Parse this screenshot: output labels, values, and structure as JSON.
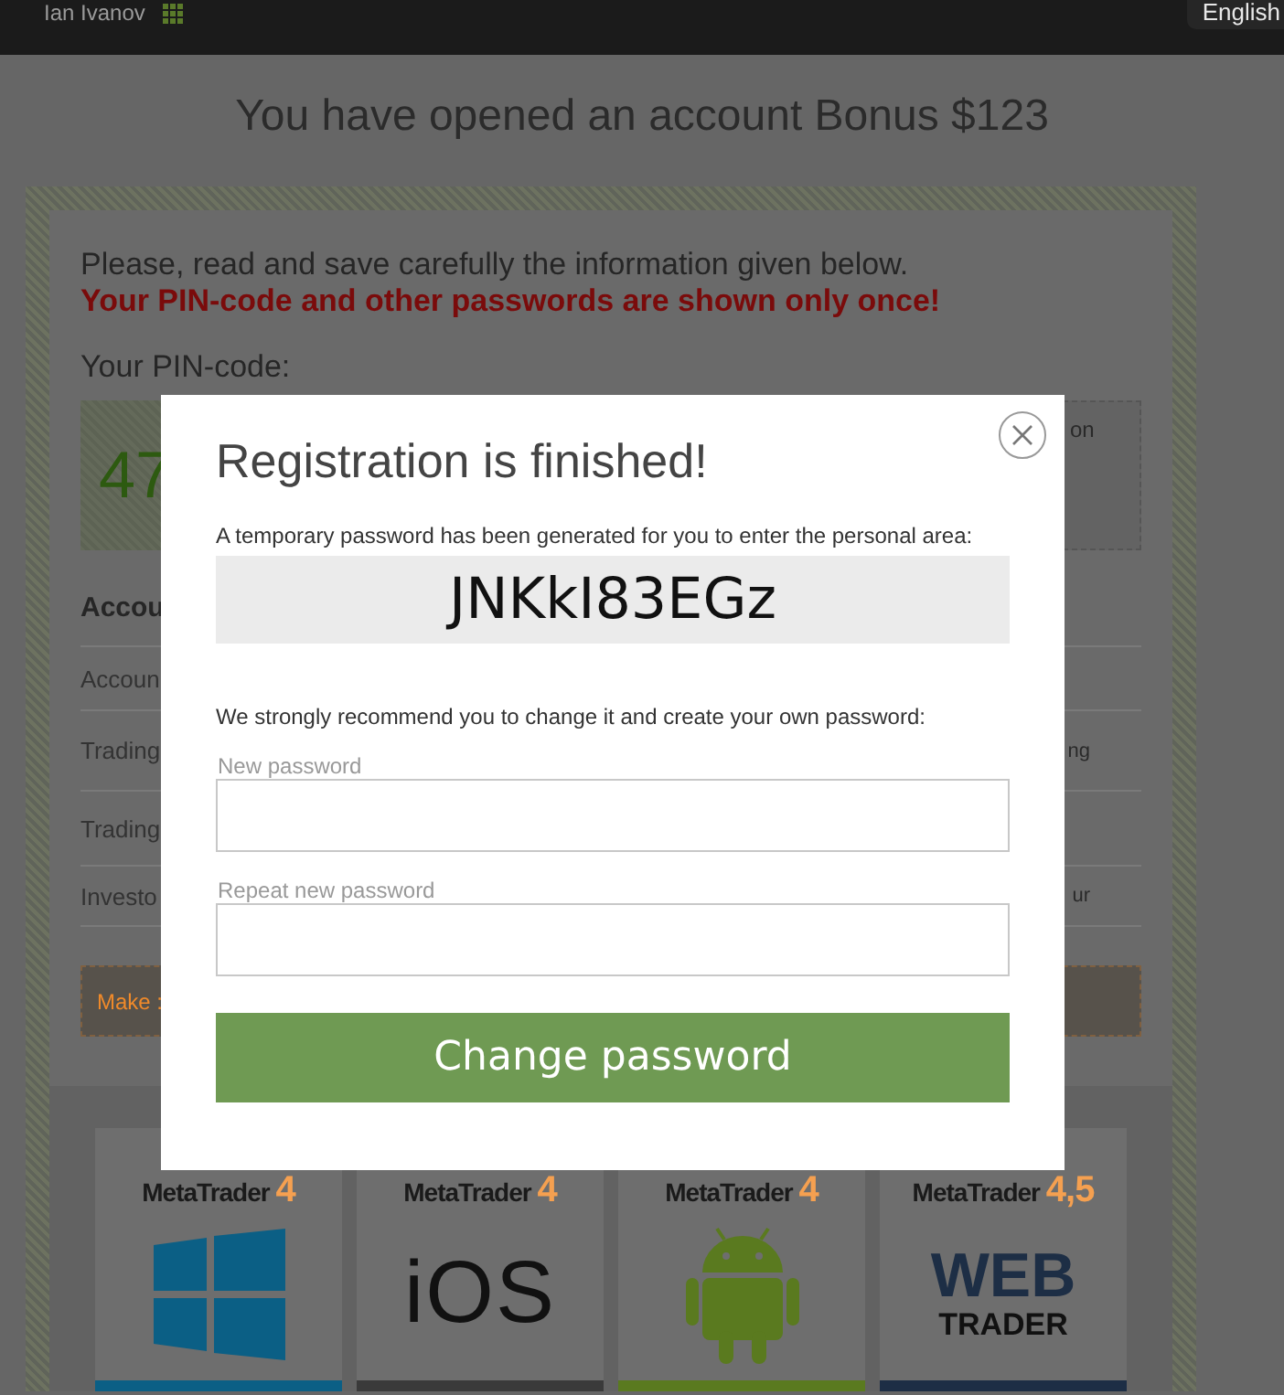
{
  "top_bar": {
    "user_name": "Ian Ivanov",
    "language": "English"
  },
  "page": {
    "title": "You have opened an account Bonus $123",
    "notice": "Please, read and save carefully the information given below.",
    "warning": "Your PIN-code and other passwords are shown only once!",
    "pin_label": "Your PIN-code:",
    "pin_value": "47",
    "pin_side_text": "on",
    "section_heading": "Accou",
    "rows": [
      {
        "label": "Accoun"
      },
      {
        "label": "Trading",
        "side": "ng"
      },
      {
        "label": "Trading"
      },
      {
        "label": "Investo",
        "side": "ur"
      }
    ],
    "tip": "Make :",
    "platforms": [
      {
        "label": "MetaTrader",
        "version": "4",
        "kind": "windows",
        "color": "#0b5f85"
      },
      {
        "label": "MetaTrader",
        "version": "4",
        "kind": "ios",
        "logo_text": "iOS",
        "color": "#3a3a3a"
      },
      {
        "label": "MetaTrader",
        "version": "4",
        "kind": "android",
        "color": "#5a7a1f"
      },
      {
        "label": "MetaTrader",
        "version": "4,5",
        "kind": "web",
        "logo_text": "WEB",
        "logo_subtext": "TRADER",
        "color": "#1d2e45"
      }
    ]
  },
  "modal": {
    "title": "Registration is finished!",
    "intro": "A temporary password has been generated for you to enter the personal area:",
    "temp_password": "JNKkI83EGz",
    "recommend": "We strongly recommend you to change it and create your own password:",
    "fields": [
      {
        "label": "New password"
      },
      {
        "label": "Repeat new password"
      }
    ],
    "button": "Change password"
  }
}
